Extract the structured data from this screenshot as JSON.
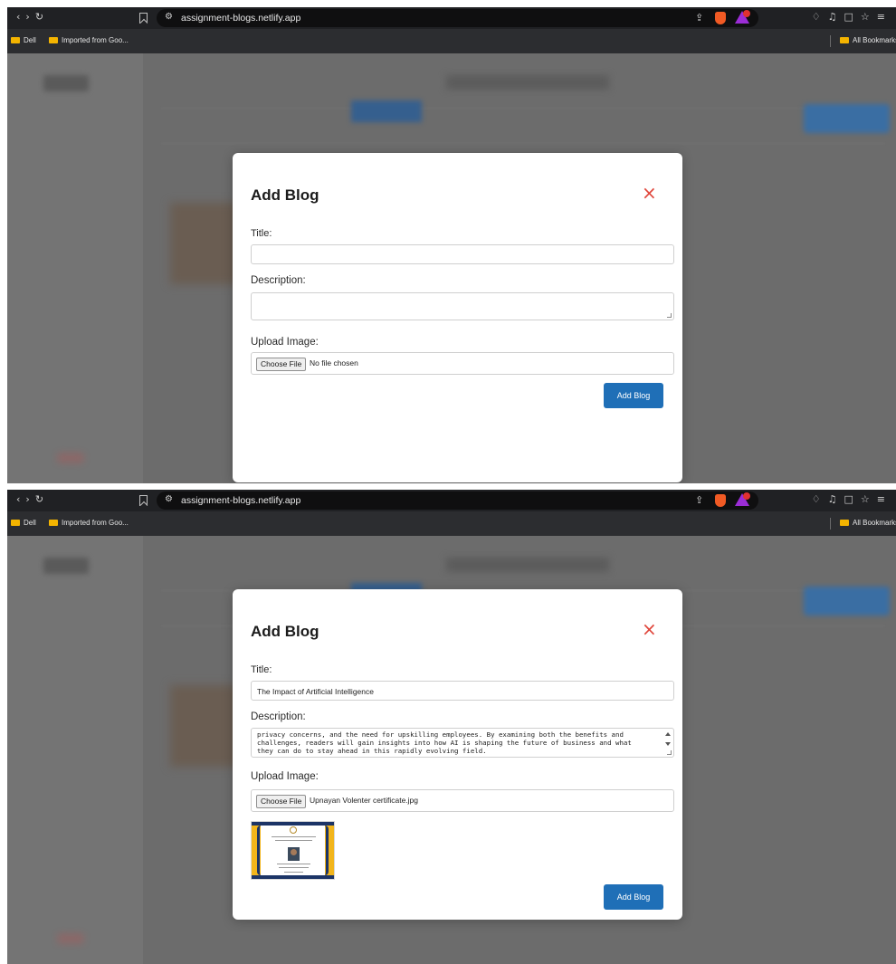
{
  "browser": {
    "url": "assignment-blogs.netlify.app",
    "bookmarks": [
      "Dell",
      "Imported from Goo...",
      "All Bookmarks"
    ]
  },
  "modal": {
    "title": "Add Blog",
    "close_label": "×",
    "title_label": "Title:",
    "description_label": "Description:",
    "upload_label": "Upload Image:",
    "choose_file_label": "Choose File",
    "submit_label": "Add Blog"
  },
  "screens": [
    {
      "title_value": "",
      "description_value": "",
      "file_name": "No file chosen",
      "has_preview": false
    },
    {
      "title_value": "The Impact of Artificial Intelligence",
      "description_value": "privacy concerns, and the need for upskilling employees. By examining both the benefits and\nchallenges, readers will gain insights into how AI is shaping the future of business and what\nthey can do to stay ahead in this rapidly evolving field.",
      "file_name": "Upnayan Volenter certificate.jpg",
      "has_preview": true
    }
  ]
}
